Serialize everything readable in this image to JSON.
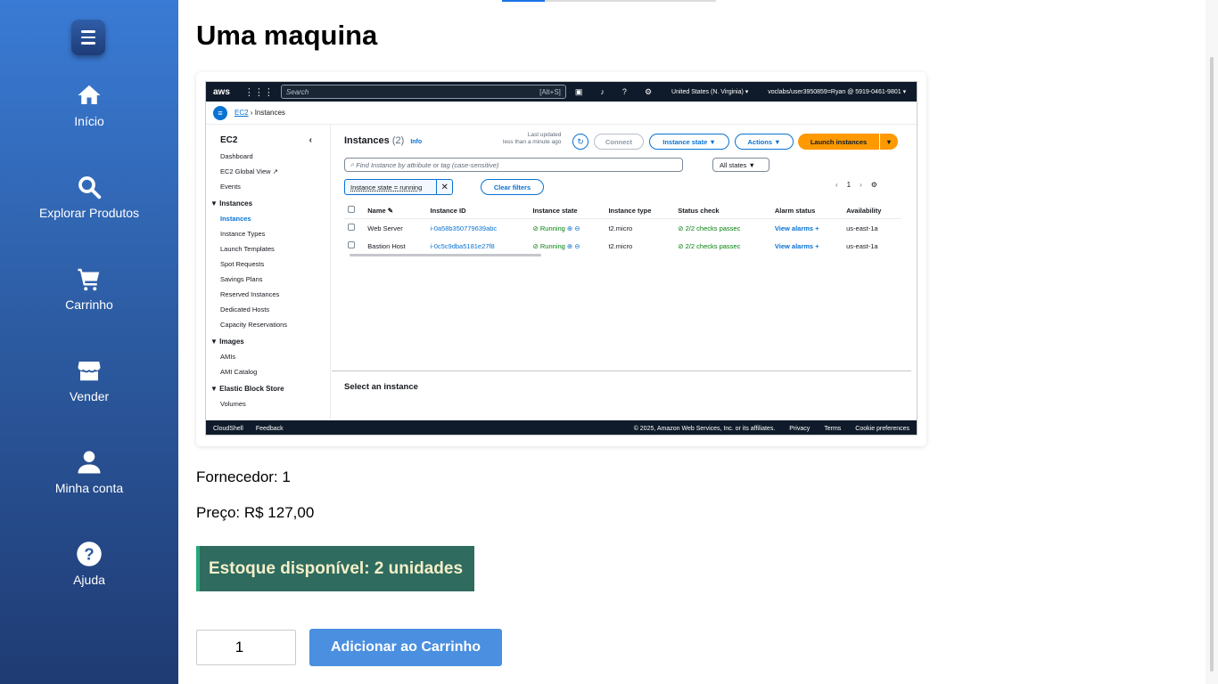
{
  "sidebar": {
    "items": [
      {
        "label": "Início",
        "icon": "home-icon"
      },
      {
        "label": "Explorar Produtos",
        "icon": "search-icon"
      },
      {
        "label": "Carrinho",
        "icon": "cart-icon"
      },
      {
        "label": "Vender",
        "icon": "store-icon"
      },
      {
        "label": "Minha conta",
        "icon": "user-icon"
      },
      {
        "label": "Ajuda",
        "icon": "help-icon"
      }
    ]
  },
  "product": {
    "title": "Uma maquina",
    "supplier": "Fornecedor: 1",
    "price": "Preço: R$ 127,00",
    "stock": "Estoque disponível: 2 unidades",
    "quantity": "1",
    "add_button": "Adicionar ao Carrinho"
  },
  "aws": {
    "logo": "aws",
    "search_placeholder": "Search",
    "search_shortcut": "[Alt+S]",
    "region": "United States (N. Virginia) ▾",
    "user": "voclabs/user3950859=Ryan @ 5919-0461-9801 ▾",
    "breadcrumb_root": "EC2",
    "breadcrumb_current": "Instances",
    "side_title": "EC2",
    "side_links_top": [
      "Dashboard",
      "EC2 Global View ↗",
      "Events"
    ],
    "section_instances": "▼ Instances",
    "instances_links": [
      "Instances",
      "Instance Types",
      "Launch Templates",
      "Spot Requests",
      "Savings Plans",
      "Reserved Instances",
      "Dedicated Hosts",
      "Capacity Reservations"
    ],
    "section_images": "▼ Images",
    "images_links": [
      "AMIs",
      "AMI Catalog"
    ],
    "section_ebs": "▼ Elastic Block Store",
    "ebs_links": [
      "Volumes"
    ],
    "heading": "Instances",
    "count": "(2)",
    "info": "Info",
    "last_updated": "Last updated",
    "last_updated_when": "less than a minute ago",
    "connect": "Connect",
    "instance_state_btn": "Instance state ▼",
    "actions_btn": "Actions ▼",
    "launch_btn": "Launch instances",
    "find_placeholder": "Find Instance by attribute or tag (case-sensitive)",
    "all_states": "All states ▼",
    "filter_token": "Instance state = running",
    "clear_filters": "Clear filters",
    "page": "1",
    "columns": [
      "Name ✎",
      "Instance ID",
      "Instance state",
      "Instance type",
      "Status check",
      "Alarm status",
      "Availability"
    ],
    "rows": [
      {
        "name": "Web Server",
        "id": "i-0a58b350779639abc",
        "state": "Running",
        "type": "t2.micro",
        "status": "2/2 checks passec",
        "alarm": "View alarms +",
        "az": "us-east-1a"
      },
      {
        "name": "Bastion Host",
        "id": "i-0c5c9dba5181e27f8",
        "state": "Running",
        "type": "t2.micro",
        "status": "2/2 checks passec",
        "alarm": "View alarms +",
        "az": "us-east-1a"
      }
    ],
    "select_instance": "Select an instance",
    "footer_cloudshell": "CloudShell",
    "footer_feedback": "Feedback",
    "footer_copyright": "© 2025, Amazon Web Services, Inc. or its affiliates.",
    "footer_privacy": "Privacy",
    "footer_terms": "Terms",
    "footer_cookies": "Cookie preferences"
  }
}
